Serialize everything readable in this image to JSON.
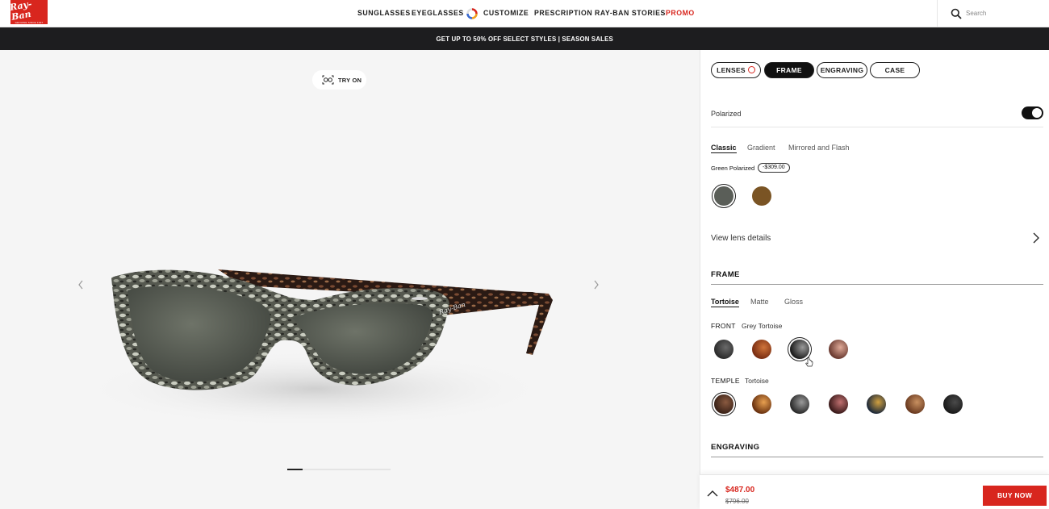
{
  "brand": {
    "logo_text": "Ray-Ban",
    "logo_sub": "GENUINE SINCE 1937",
    "color": "#d8261e"
  },
  "nav": {
    "items": [
      {
        "label": "SUNGLASSES"
      },
      {
        "label": "EYEGLASSES"
      },
      {
        "label": "CUSTOMIZE",
        "icon": "customize-icon"
      },
      {
        "label": "PRESCRIPTION"
      },
      {
        "label": "RAY-BAN STORIES"
      },
      {
        "label": "PROMO",
        "color": "#d8261e"
      }
    ],
    "search_placeholder": "Search"
  },
  "promo_banner": "GET UP TO 50% OFF SELECT STYLES | SEASON SALES",
  "viewer": {
    "try_on_label": "TRY ON",
    "pager": {
      "total": 7,
      "active": 1
    }
  },
  "customizer": {
    "tabs": [
      {
        "label": "LENSES",
        "active": false
      },
      {
        "label": "FRAME",
        "active": true
      },
      {
        "label": "ENGRAVING",
        "active": false
      },
      {
        "label": "CASE",
        "active": false
      }
    ],
    "polarized": {
      "label": "Polarized",
      "on": true
    },
    "lens_tabs": [
      "Classic",
      "Gradient",
      "Mirrored and Flash"
    ],
    "lens_tab_active": "Classic",
    "lens_selected_name": "Green Polarized",
    "lens_price_delta": "-$309.00",
    "lens_swatches": [
      {
        "name": "green-polarized",
        "color": "#5a5e58",
        "selected": true
      },
      {
        "name": "brown",
        "color": "#7a5424",
        "selected": false
      }
    ],
    "view_lens_details": "View lens details",
    "frame": {
      "title": "FRAME",
      "finish_tabs": [
        "Tortoise",
        "Matte",
        "Gloss"
      ],
      "finish_active": "Tortoise",
      "front_label": "FRONT",
      "front_value": "Grey Tortoise",
      "front_swatches": [
        {
          "name": "dark-tortoise",
          "colors": [
            "#2b2b2b",
            "#6a6a6a"
          ],
          "selected": false
        },
        {
          "name": "havana",
          "colors": [
            "#7a2e12",
            "#d0743a"
          ],
          "selected": false
        },
        {
          "name": "grey-tortoise",
          "colors": [
            "#1e1e1e",
            "#9a9a9a"
          ],
          "selected": true
        },
        {
          "name": "pink-tortoise",
          "colors": [
            "#6a3a30",
            "#e0aa98"
          ],
          "selected": false
        }
      ],
      "temple_label": "TEMPLE",
      "temple_value": "Tortoise",
      "temple_swatches": [
        {
          "name": "tortoise",
          "colors": [
            "#3a2218",
            "#8a5a40"
          ],
          "selected": true
        },
        {
          "name": "havana-light",
          "colors": [
            "#6a3210",
            "#e8a050"
          ],
          "selected": false
        },
        {
          "name": "grey",
          "colors": [
            "#2a2a2a",
            "#9a9a9a"
          ],
          "selected": false
        },
        {
          "name": "red-tortoise",
          "colors": [
            "#3a1a1a",
            "#c07070"
          ],
          "selected": false
        },
        {
          "name": "blue-tortoise",
          "colors": [
            "#1e2a3a",
            "#d0a040"
          ],
          "selected": false
        },
        {
          "name": "brown-light",
          "colors": [
            "#6a3a20",
            "#c89060"
          ],
          "selected": false
        },
        {
          "name": "black",
          "colors": [
            "#1a1a1a",
            "#4a4a4a"
          ],
          "selected": false
        }
      ]
    },
    "engraving_title": "ENGRAVING"
  },
  "checkout": {
    "price": "$487.00",
    "original_price": "$796.00",
    "buy_label": "BUY NOW"
  }
}
